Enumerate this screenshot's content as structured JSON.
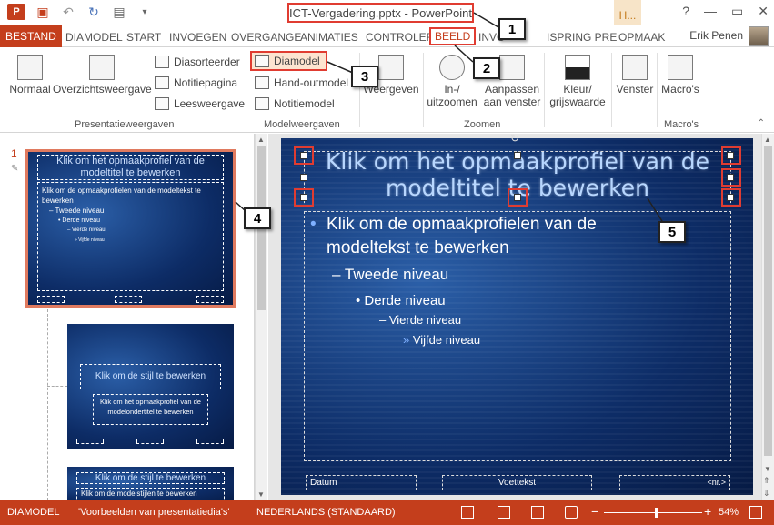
{
  "window": {
    "title": "ICT-Vergadering.pptx - PowerPoint",
    "help_tab": "H...",
    "controls": [
      "?",
      "—",
      "▭",
      "✕"
    ]
  },
  "quick_access": [
    "P",
    "save-icon",
    "undo-icon",
    "redo-icon",
    "slideshow-icon",
    "customize-icon"
  ],
  "tabs": [
    {
      "label": "BESTAND"
    },
    {
      "label": "DIAMODEL"
    },
    {
      "label": "START"
    },
    {
      "label": "INVOEGEN"
    },
    {
      "label": "OVERGANGE"
    },
    {
      "label": "ANIMATIES"
    },
    {
      "label": "CONTROLER"
    },
    {
      "label": "BEELD"
    },
    {
      "label": "INVO"
    },
    {
      "label": "ISPRING PRE"
    },
    {
      "label": "OPMAAK"
    }
  ],
  "user": "Erik Penen",
  "ribbon": {
    "presentation_views": {
      "label": "Presentatieweergaven",
      "normaal": "Normaal",
      "overzicht": "Overzichtsweergave",
      "diasorteerder": "Diasorteerder",
      "notitiepagina": "Notitiepagina",
      "leesweergave": "Leesweergave"
    },
    "master_views": {
      "label": "Modelweergaven",
      "diamodel": "Diamodel",
      "handout": "Hand-outmodel",
      "notitiemodel": "Notitiemodel"
    },
    "weergeven": "Weergeven",
    "zoom": {
      "label": "Zoomen",
      "in_uit_1": "In-/",
      "in_uit_2": "uitzoomen",
      "aanpassen_1": "Aanpassen",
      "aanpassen_2": "aan venster"
    },
    "kleur_1": "Kleur/",
    "kleur_2": "grijswaarde",
    "vensters": "Venster",
    "macros": "Macro's",
    "macros_group": "Macro's"
  },
  "callouts": [
    "1",
    "2",
    "3",
    "4",
    "5"
  ],
  "thumbnails": {
    "slide_number": "1",
    "t1_title": "Klik om het opmaakprofiel van de modeltitel te bewerken",
    "t1_body": "Klik om de opmaakprofielen van de modeltekst te bewerken",
    "t1_l2": "– Tweede niveau",
    "t1_l3": "• Derde niveau",
    "t1_l4": "– Vierde niveau",
    "t1_l5": "» Vijfde niveau",
    "t2_title": "Klik om de stijl te bewerken",
    "t2_body": "Klik om het opmaakprofiel van de modelondertitel te bewerken",
    "t3_title": "Klik om de stijl te bewerken",
    "t3_body": "Klik om de modelstijlen te bewerken"
  },
  "slide": {
    "title": "Klik om het opmaakprofiel van de modeltitel te bewerken",
    "level1": "Klik om de opmaakprofielen van de modeltekst te bewerken",
    "level2": "Tweede niveau",
    "level3": "Derde niveau",
    "level4": "Vierde niveau",
    "level5": "Vijfde niveau",
    "footer_date": "Datum",
    "footer_text": "Voettekst",
    "footer_num": "<nr.>"
  },
  "status": {
    "mode": "DIAMODEL",
    "theme": "'Voorbeelden van presentatiedia's'",
    "language": "NEDERLANDS (STANDAARD)",
    "zoom": "54%",
    "zoom_level": 0.54
  },
  "colors": {
    "accent": "#c43e1c",
    "highlight": "#e03c31",
    "slide_dark": "#0d2c66",
    "title_text": "#b8d7ff"
  }
}
